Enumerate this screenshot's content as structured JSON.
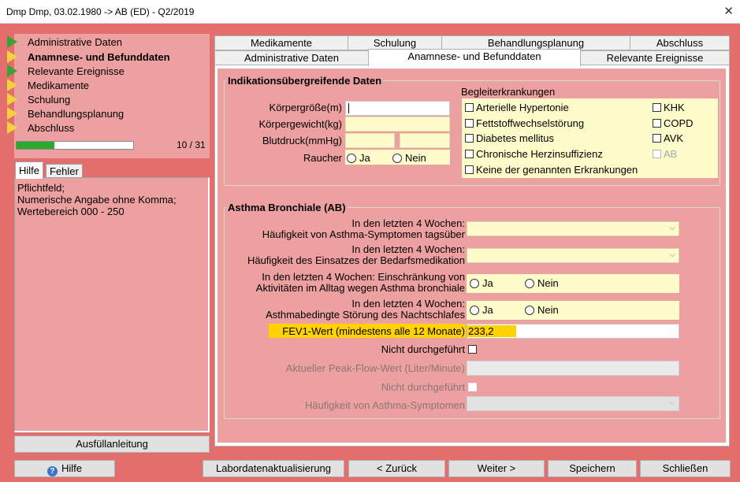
{
  "window": {
    "title": "Dmp Dmp, 03.02.1980 -> AB (ED) - Q2/2019",
    "close": "✕"
  },
  "nav": {
    "items": [
      {
        "label": "Administrative Daten",
        "status": "green",
        "bold": false
      },
      {
        "label": "Anamnese- und Befunddaten",
        "status": "yellow",
        "bold": true
      },
      {
        "label": "Relevante Ereignisse",
        "status": "green",
        "bold": false
      },
      {
        "label": "Medikamente",
        "status": "yellow",
        "bold": false
      },
      {
        "label": "Schulung",
        "status": "yellow",
        "bold": false
      },
      {
        "label": "Behandlungsplanung",
        "status": "yellow",
        "bold": false
      },
      {
        "label": "Abschluss",
        "status": "yellow",
        "bold": false
      }
    ],
    "progress_fraction": 0.323,
    "progress_text": "10 / 31"
  },
  "help": {
    "tabs": [
      "Hilfe",
      "Fehler"
    ],
    "lines": [
      "Pflichtfeld;",
      "Numerische Angabe ohne Komma;",
      "Wertebereich 000 - 250"
    ],
    "button": "Ausfüllanleitung"
  },
  "tabs": {
    "row1": [
      "Medikamente",
      "Schulung",
      "Behandlungsplanung",
      "Abschluss"
    ],
    "row2": [
      "Administrative Daten",
      "Anamnese- und Befunddaten",
      "Relevante Ereignisse"
    ],
    "active": "Anamnese- und Befunddaten"
  },
  "indikation": {
    "title": "Indikationsübergreifende Daten",
    "groesse_label": "Körpergröße(m)",
    "gewicht_label": "Körpergewicht(kg)",
    "blutdruck_label": "Blutdruck(mmHg)",
    "raucher_label": "Raucher",
    "ja": "Ja",
    "nein": "Nein",
    "begleit_title": "Begleiterkrankungen",
    "begleit_left": [
      "Arterielle Hypertonie",
      "Fettstoffwechselstörung",
      "Diabetes mellitus",
      "Chronische Herzinsuffizienz",
      "Keine der genannten Erkrankungen"
    ],
    "begleit_right": [
      "KHK",
      "COPD",
      "AVK",
      "AB"
    ]
  },
  "asthma": {
    "title": "Asthma Bronchiale (AB)",
    "q1_line1": "In den letzten 4 Wochen:",
    "q1_line2": "Häufigkeit von Asthma-Symptomen tagsüber",
    "q2_line1": "In den letzten 4 Wochen:",
    "q2_line2": "Häufigkeit des Einsatzes der Bedarfsmedikation",
    "q3_line1": "In den letzten 4 Wochen: Einschränkung von",
    "q3_line2": "Aktivitäten im Alltag wegen Asthma bronchiale",
    "q4_line1": "In den letzten 4 Wochen:",
    "q4_line2": "Asthmabedingte Störung des Nachtschlafes",
    "ja": "Ja",
    "nein": "Nein",
    "fev1_label": "FEV1-Wert (mindestens alle 12 Monate)",
    "fev1_value": "233,2",
    "nicht_durchgefuehrt": "Nicht durchgeführt",
    "peakflow_label": "Aktueller Peak-Flow-Wert (Liter/Minute)",
    "haeufigkeit_label": "Häufigkeit von Asthma-Symptomen",
    "chevron": "⌵"
  },
  "bottom": {
    "hilfe": "Hilfe",
    "labor": "Labordatenaktualisierung",
    "zurueck": "< Zurück",
    "weiter": "Weiter >",
    "speichern": "Speichern",
    "schliessen": "Schließen"
  }
}
